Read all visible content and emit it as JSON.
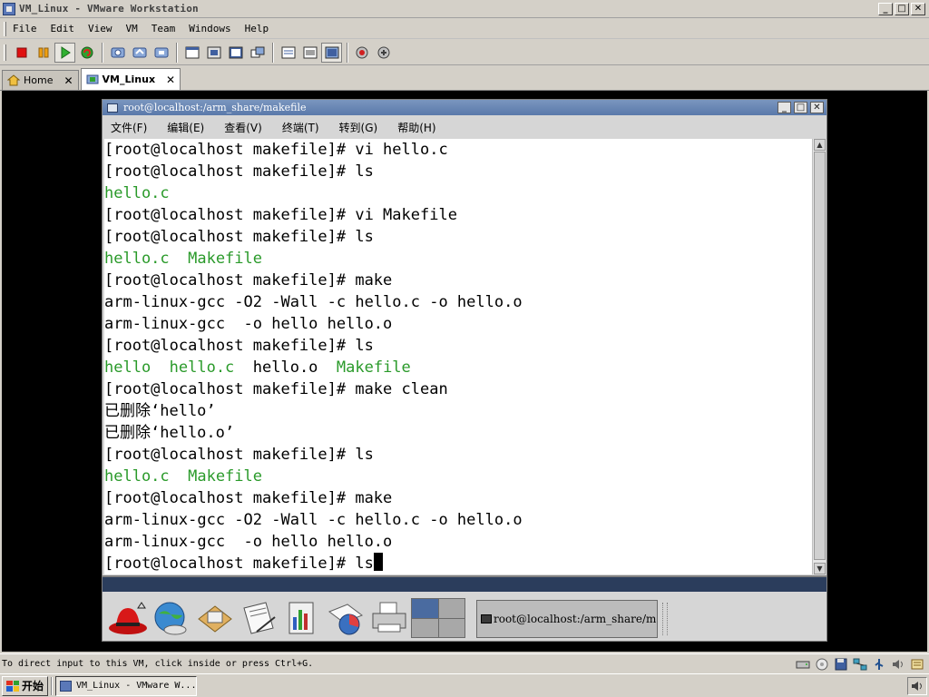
{
  "window": {
    "title": "VM_Linux - VMware Workstation",
    "minimize": "_",
    "maximize": "□",
    "close": "✕"
  },
  "menubar": {
    "items": [
      "File",
      "Edit",
      "View",
      "VM",
      "Team",
      "Windows",
      "Help"
    ]
  },
  "toolbar": {
    "buttons": [
      "stop-icon",
      "pause-icon",
      "play-icon",
      "reset-icon",
      "snapshot-icon",
      "revert-snapshot-icon",
      "snapshot-manager-icon",
      "normal-view-icon",
      "full-screen-icon",
      "quick-switch-icon",
      "summary-view-icon",
      "console-view-icon",
      "appliance-view-icon",
      "capture-icon",
      "settings-icon"
    ]
  },
  "tabs": [
    {
      "label": "Home",
      "close": "✕",
      "active": false
    },
    {
      "label": "VM_Linux",
      "close": "✕",
      "active": true
    }
  ],
  "terminal": {
    "title": "root@localhost:/arm_share/makefile",
    "menus": [
      "文件(F)",
      "编辑(E)",
      "查看(V)",
      "终端(T)",
      "转到(G)",
      "帮助(H)"
    ],
    "lines": [
      {
        "text": "[root@localhost makefile]# vi hello.c",
        "color": "default"
      },
      {
        "text": "[root@localhost makefile]# ls",
        "color": "default"
      },
      {
        "text": "hello.c",
        "color": "green"
      },
      {
        "text": "[root@localhost makefile]# vi Makefile",
        "color": "default"
      },
      {
        "text": "[root@localhost makefile]# ls",
        "color": "default"
      },
      {
        "text": "hello.c  Makefile",
        "color": "green"
      },
      {
        "text": "[root@localhost makefile]# make",
        "color": "default"
      },
      {
        "text": "arm-linux-gcc -O2 -Wall -c hello.c -o hello.o",
        "color": "default"
      },
      {
        "text": "arm-linux-gcc  -o hello hello.o",
        "color": "default"
      },
      {
        "text": "[root@localhost makefile]# ls",
        "color": "default"
      },
      {
        "text": "hello  hello.c  hello.o  Makefile",
        "color": "mixed"
      },
      {
        "text": "[root@localhost makefile]# make clean",
        "color": "default"
      },
      {
        "text": "已删除‘hello’",
        "color": "default"
      },
      {
        "text": "已删除‘hello.o’",
        "color": "default"
      },
      {
        "text": "[root@localhost makefile]# ls",
        "color": "default"
      },
      {
        "text": "hello.c  Makefile",
        "color": "green"
      },
      {
        "text": "[root@localhost makefile]# make",
        "color": "default"
      },
      {
        "text": "arm-linux-gcc -O2 -Wall -c hello.c -o hello.o",
        "color": "default"
      },
      {
        "text": "arm-linux-gcc  -o hello hello.o",
        "color": "default"
      },
      {
        "text": "[root@localhost makefile]# ls",
        "color": "default"
      }
    ],
    "mixed_line_parts": [
      {
        "text": "hello  hello.c  ",
        "color": "green"
      },
      {
        "text": "hello.o  ",
        "color": "default"
      },
      {
        "text": "Makefile",
        "color": "green"
      }
    ],
    "green_color": "#2a9a2a"
  },
  "panel": {
    "launchers": [
      "redhat-menu-icon",
      "web-browser-icon",
      "email-icon",
      "writer-icon",
      "calc-icon",
      "impress-icon",
      "printer-icon"
    ],
    "task_label": "root@localhost:/arm_share/makefile"
  },
  "statusbar": {
    "text": "To direct input to this VM, click inside or press Ctrl+G."
  },
  "taskbar": {
    "start_label": "开始",
    "task_label": "VM_Linux - VMware W..."
  },
  "colors": {
    "term_title": "#5a79aa",
    "panel_strip": "#2b3d5c",
    "pager_active": "#4a6ba0"
  }
}
